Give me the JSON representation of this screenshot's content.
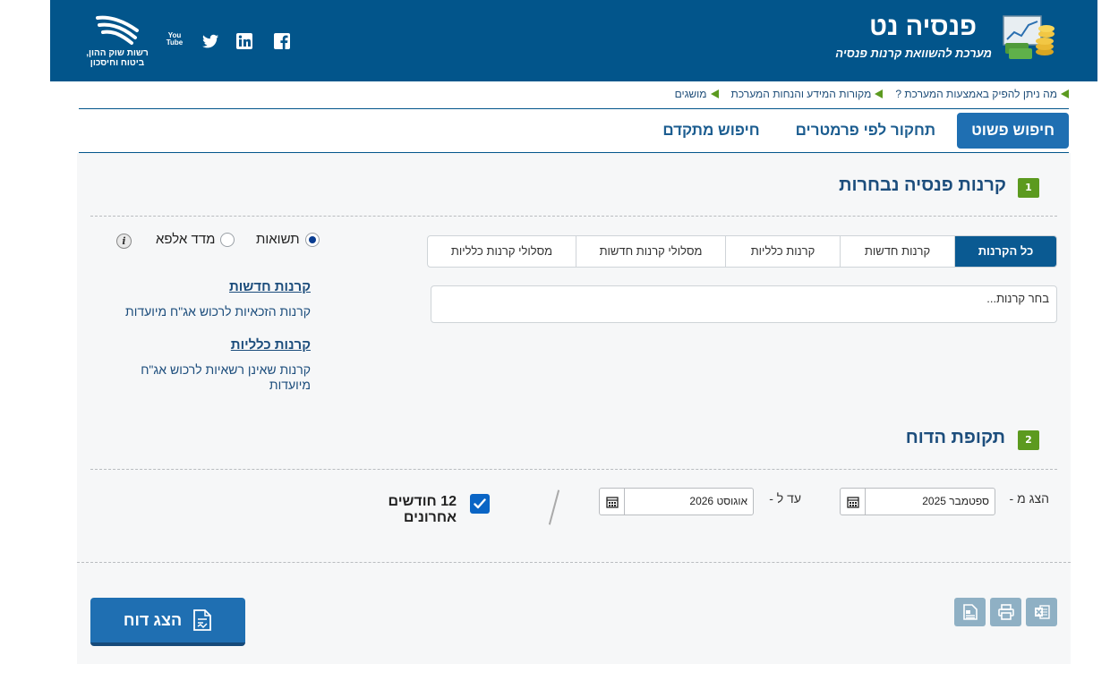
{
  "header": {
    "title": "פנסיה נט",
    "subtitle": "מערכת להשוואת קרנות פנסיה",
    "regulator_line1": "רשות שוק ההון,",
    "regulator_line2": "ביטוח וחיסכון",
    "youtube_label": "You Tube",
    "colors": {
      "background": "#02558b",
      "accent_green": "#5c9a1f"
    },
    "social_icons": [
      "facebook-icon",
      "linkedin-icon",
      "twitter-icon",
      "youtube-icon"
    ]
  },
  "top_links": [
    {
      "label": "מה ניתן להפיק באמצעות המערכת ?"
    },
    {
      "label": "מקורות המידע והנחות המערכת"
    },
    {
      "label": "מושגים"
    }
  ],
  "main_tabs": [
    {
      "label": "חיפוש פשוט",
      "active": true
    },
    {
      "label": "תחקור לפי פרמטרים",
      "active": false
    },
    {
      "label": "חיפוש מתקדם",
      "active": false
    }
  ],
  "section1": {
    "number": "1",
    "title": "קרנות פנסיה נבחרות",
    "fund_tabs": [
      {
        "label": "כל הקרנות",
        "active": true
      },
      {
        "label": "קרנות חדשות",
        "active": false
      },
      {
        "label": "קרנות כלליות",
        "active": false
      },
      {
        "label": "מסלולי קרנות חדשות",
        "active": false
      },
      {
        "label": "מסלולי קרנות כלליות",
        "active": false
      }
    ],
    "fund_select_placeholder": "בחר קרנות...",
    "radio_options": [
      {
        "label": "תשואות",
        "selected": true
      },
      {
        "label": "מדד אלפא",
        "selected": false
      }
    ],
    "info_icon_glyph": "i",
    "new_funds_heading": "קרנות חדשות",
    "new_funds_desc": "קרנות הזכאיות לרכוש אג\"ח מיועדות",
    "general_funds_heading": "קרנות כלליות",
    "general_funds_desc": "קרנות שאינן רשאיות לרכוש אג\"ח מיועדות"
  },
  "section2": {
    "number": "2",
    "title": "תקופת הדוח",
    "from_label": "הצג מ -",
    "from_value": "ספטמבר 2025",
    "to_label": "עד ל -",
    "to_value": "אוגוסט 2026",
    "last12_label": "12 חודשים אחרונים",
    "last12_checked": true
  },
  "footer": {
    "export_buttons": [
      "excel-icon",
      "print-icon",
      "document-icon"
    ],
    "show_report_label": "הצג דוח"
  }
}
